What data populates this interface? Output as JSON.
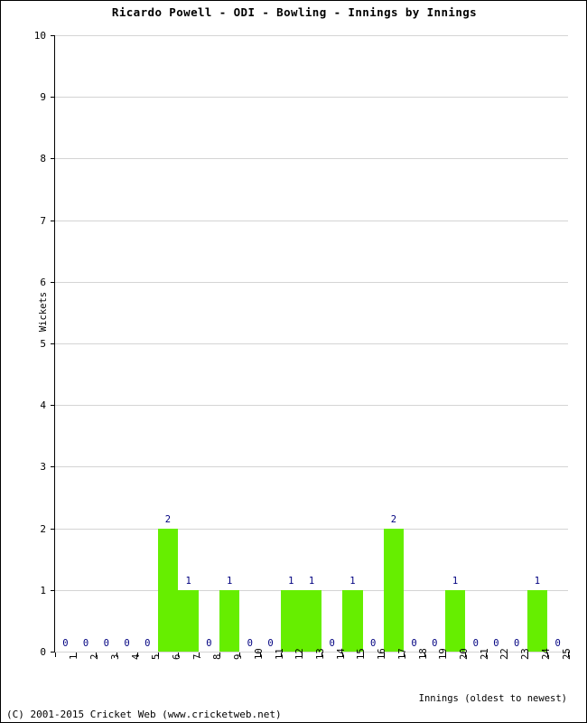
{
  "chart_data": {
    "type": "bar",
    "title": "Ricardo Powell - ODI - Bowling - Innings by Innings",
    "xlabel": "Innings (oldest to newest)",
    "ylabel": "Wickets",
    "categories": [
      "1",
      "2",
      "3",
      "4",
      "5",
      "6",
      "7",
      "8",
      "9",
      "10",
      "11",
      "12",
      "13",
      "14",
      "15",
      "16",
      "17",
      "18",
      "19",
      "20",
      "21",
      "22",
      "23",
      "24",
      "25"
    ],
    "values": [
      0,
      0,
      0,
      0,
      0,
      2,
      1,
      0,
      1,
      0,
      0,
      1,
      1,
      0,
      1,
      0,
      2,
      0,
      0,
      1,
      0,
      0,
      0,
      1,
      0
    ],
    "ylim": [
      0,
      10
    ],
    "yticks": [
      0,
      1,
      2,
      3,
      4,
      5,
      6,
      7,
      8,
      9,
      10
    ],
    "grid": true,
    "legend": "none",
    "bar_color": "#66ee00",
    "value_label_color": "#000080",
    "gridline_color": "#d4d4d4",
    "axis_color": "#000000"
  },
  "footer": {
    "copyright": "(C) 2001-2015 Cricket Web (www.cricketweb.net)"
  }
}
